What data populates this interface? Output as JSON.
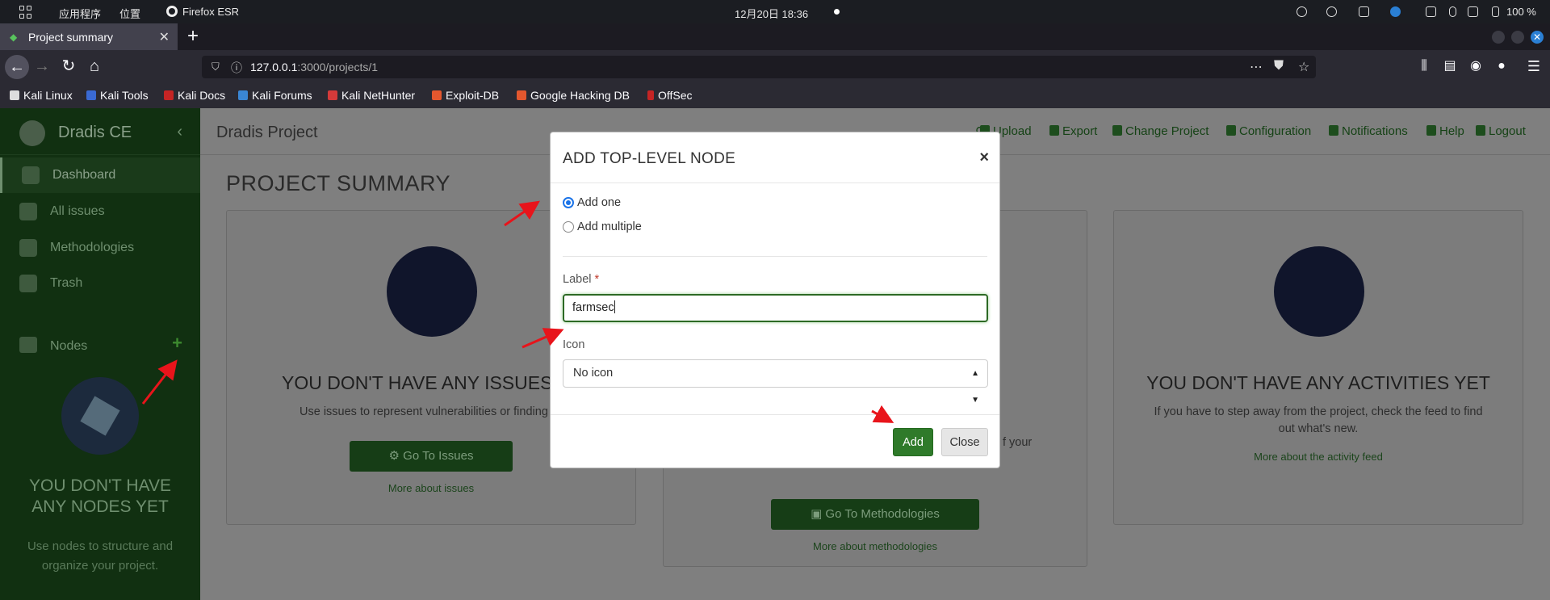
{
  "os": {
    "apps_label": "应用程序",
    "places_label": "位置",
    "browser_label": "Firefox ESR",
    "clock": "12月20日 18:36",
    "battery": "100 %"
  },
  "browser": {
    "tab_title": "Project summary",
    "url_host": "127.0.0.1",
    "url_rest": ":3000/projects/1",
    "bookmarks": [
      "Kali Linux",
      "Kali Tools",
      "Kali Docs",
      "Kali Forums",
      "Kali NetHunter",
      "Exploit-DB",
      "Google Hacking DB",
      "OffSec"
    ]
  },
  "sidebar": {
    "brand": "Dradis CE",
    "items": [
      {
        "label": "Dashboard",
        "icon": "dashboard-icon"
      },
      {
        "label": "All issues",
        "icon": "bug-icon"
      },
      {
        "label": "Methodologies",
        "icon": "board-icon"
      },
      {
        "label": "Trash",
        "icon": "trash-icon"
      }
    ],
    "nodes_label": "Nodes",
    "empty_title": "YOU DON'T HAVE ANY NODES YET",
    "empty_text": "Use nodes to structure and organize your project."
  },
  "header": {
    "title": "Dradis Project",
    "nav": [
      "Upload",
      "Export",
      "Change Project",
      "Configuration",
      "Notifications",
      "Help",
      "Logout"
    ]
  },
  "main": {
    "summary_title": "PROJECT SUMMARY",
    "cards": [
      {
        "title": "YOU DON'T HAVE ANY ISSUES Y",
        "text": "Use issues to represent vulnerabilities or finding",
        "button": "Go To Issues",
        "link": "More about issues"
      },
      {
        "title": "",
        "text": "f your",
        "button": "Go To Methodologies",
        "link": "More about methodologies"
      },
      {
        "title": "YOU DON'T HAVE ANY ACTIVITIES YET",
        "text": "If you have to step away from the project, check the feed to find out what's new.",
        "button": "",
        "link": "More about the activity feed"
      }
    ]
  },
  "modal": {
    "title": "ADD TOP-LEVEL NODE",
    "close_glyph": "×",
    "radio_one": "Add one",
    "radio_multiple": "Add multiple",
    "label_field_label": "Label",
    "required_mark": "*",
    "label_value": "farmsec",
    "icon_field_label": "Icon",
    "icon_value": "No icon",
    "add_button": "Add",
    "close_button": "Close"
  },
  "colors": {
    "sidebar_bg": "#113011",
    "accent_green": "#2f7a2a",
    "annotation_red": "#e8141b"
  }
}
